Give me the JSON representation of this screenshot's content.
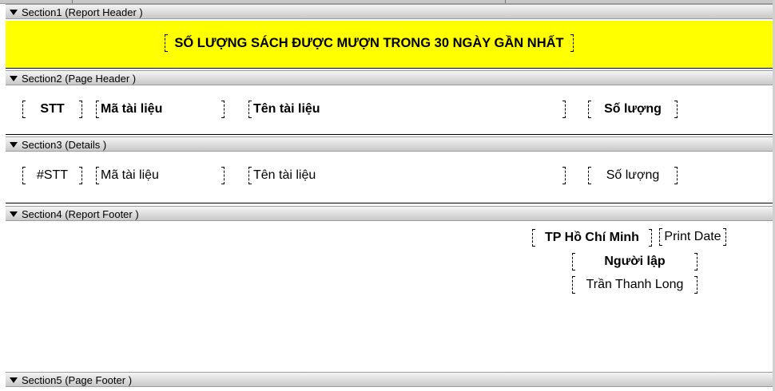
{
  "sections": {
    "s1": "Section1 (Report Header )",
    "s2": "Section2 (Page Header )",
    "s3": "Section3 (Details )",
    "s4": "Section4 (Report Footer )",
    "s5": "Section5 (Page Footer )"
  },
  "report_header": {
    "title": "SỐ LƯỢNG SÁCH ĐƯỢC MƯỢN TRONG 30 NGÀY GẦN NHẤT"
  },
  "page_header": {
    "stt": "STT",
    "ma": "Mã tài liệu",
    "ten": "Tên tài liệu",
    "so_luong": "Số lượng"
  },
  "details": {
    "stt": "#STT",
    "ma": "Mã tài liệu",
    "ten": "Tên tài liệu",
    "so_luong": "Số lượng"
  },
  "report_footer": {
    "city": "TP Hồ Chí Minh",
    "print_date": "Print Date",
    "creator_label": "Người lập",
    "creator_name": "Trần Thanh Long"
  },
  "colors": {
    "title_band": "#ffff00",
    "section_bar": "#dcdcdc"
  }
}
